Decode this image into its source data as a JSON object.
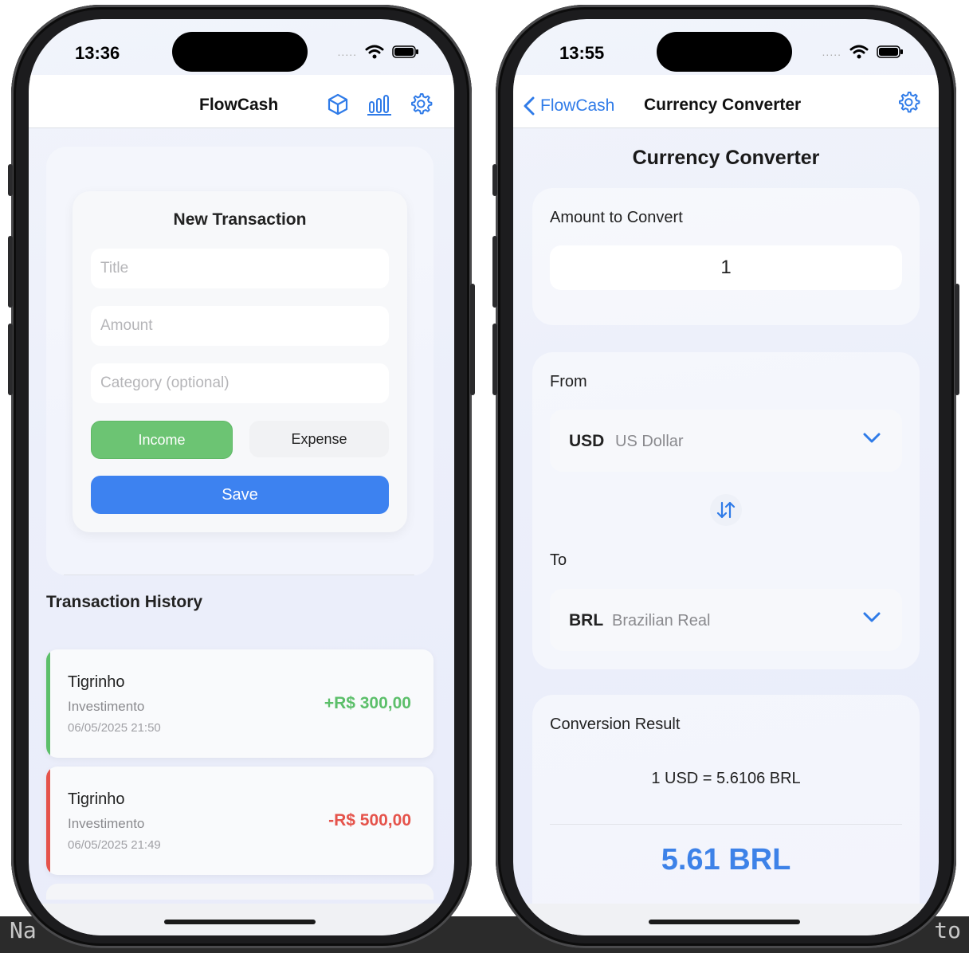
{
  "background": {
    "terminal_left": "Na",
    "terminal_right": "to"
  },
  "left_screen": {
    "status": {
      "time": "13:36",
      "signal_dots": "....."
    },
    "nav": {
      "title": "FlowCash"
    },
    "form": {
      "title": "New Transaction",
      "title_placeholder": "Title",
      "amount_placeholder": "Amount",
      "category_placeholder": "Category (optional)",
      "income_label": "Income",
      "expense_label": "Expense",
      "save_label": "Save"
    },
    "history": {
      "title": "Transaction History",
      "items": [
        {
          "title": "Tigrinho",
          "category": "Investimento",
          "date": "06/05/2025 21:50",
          "amount": "+R$ 300,00",
          "type": "income",
          "color": "#5cbf6a"
        },
        {
          "title": "Tigrinho",
          "category": "Investimento",
          "date": "06/05/2025 21:49",
          "amount": "-R$ 500,00",
          "type": "expense",
          "color": "#e5534b"
        }
      ]
    }
  },
  "right_screen": {
    "status": {
      "time": "13:55",
      "signal_dots": "....."
    },
    "nav": {
      "back_label": "FlowCash",
      "title": "Currency Converter"
    },
    "heading": "Currency Converter",
    "amount_section": {
      "label": "Amount to Convert",
      "value": "1"
    },
    "from_section": {
      "label": "From",
      "code": "USD",
      "name": "US Dollar"
    },
    "to_section": {
      "label": "To",
      "code": "BRL",
      "name": "Brazilian Real"
    },
    "result_section": {
      "label": "Conversion Result",
      "rate": "1 USD = 5.6106 BRL",
      "value": "5.61 BRL"
    }
  },
  "colors": {
    "accent_blue": "#3d82f0",
    "income_green": "#6cc473",
    "expense_red": "#e5534b"
  }
}
